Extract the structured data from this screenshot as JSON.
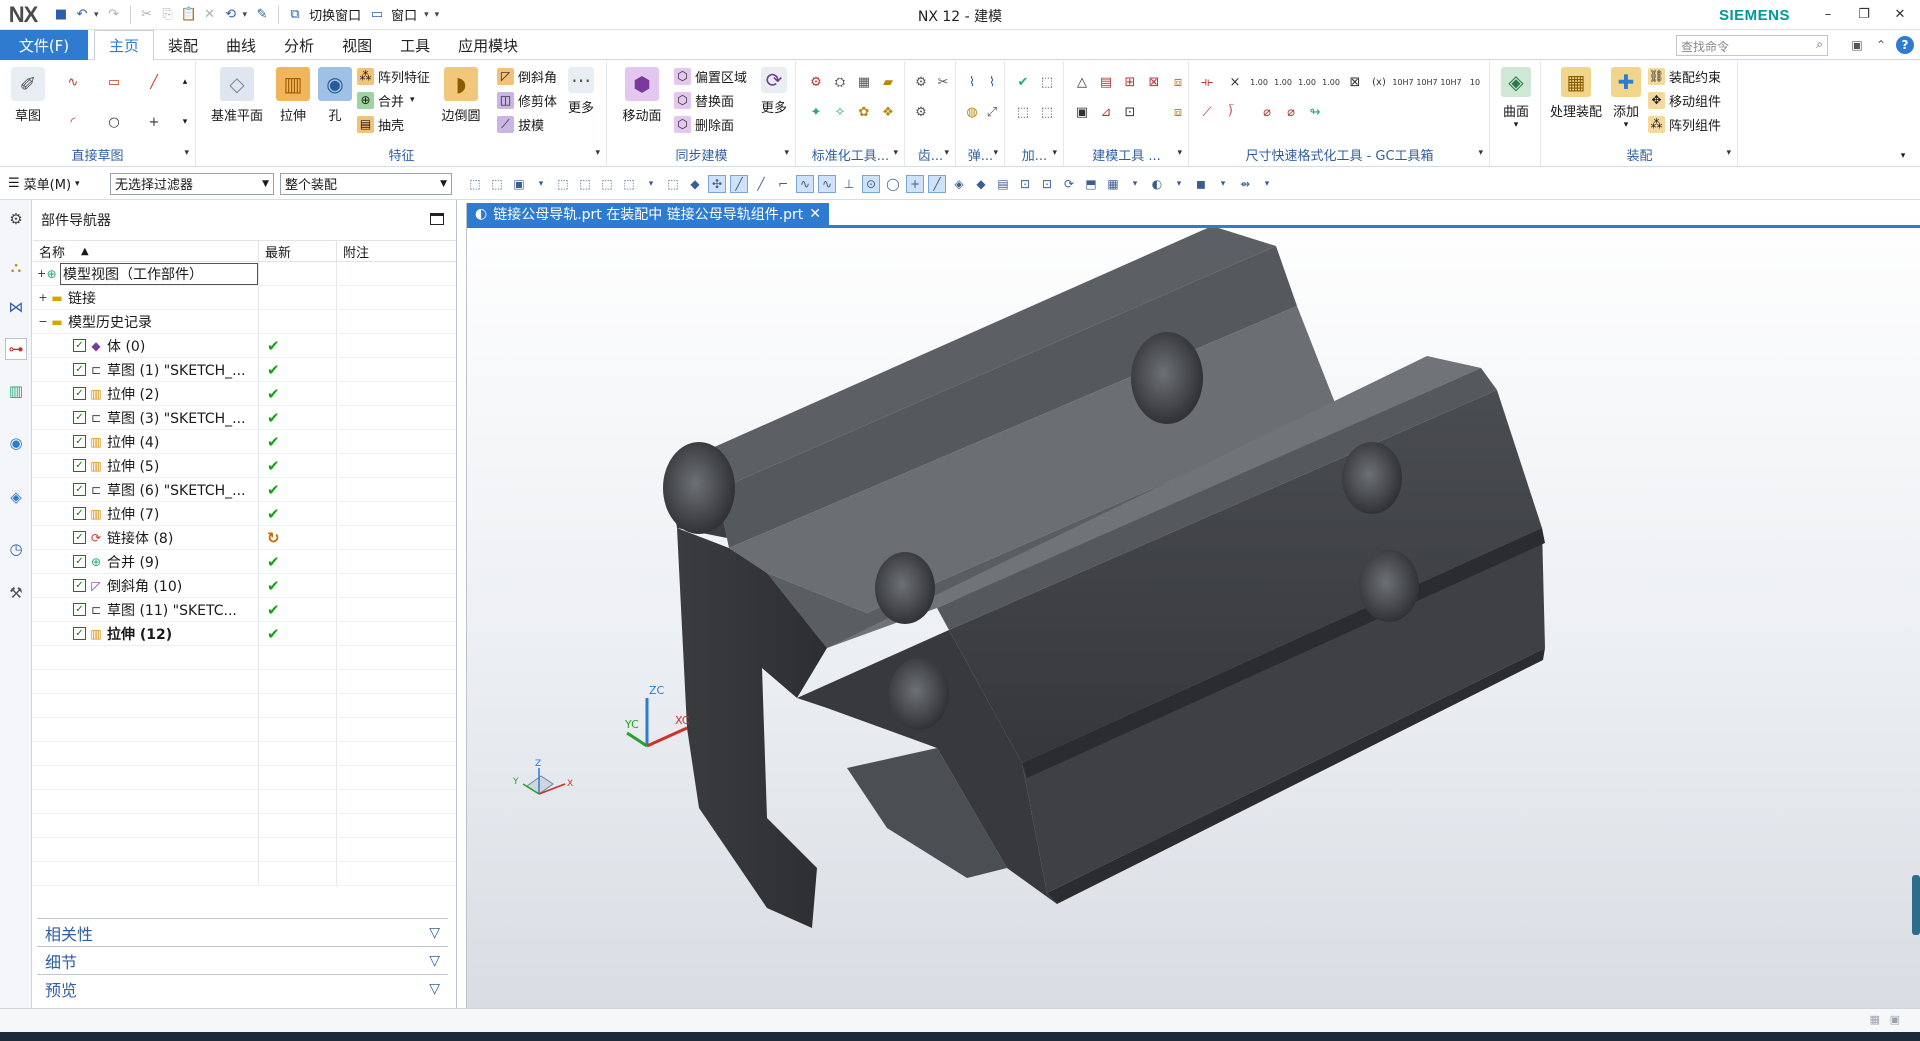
{
  "app": {
    "logo": "NX",
    "window_title": "NX 12 - 建模",
    "brand": "SIEMENS",
    "quick_access": {
      "switch_window": "切换窗口",
      "window": "窗口"
    }
  },
  "menu": {
    "file": "文件(F)",
    "tabs": [
      "主页",
      "装配",
      "曲线",
      "分析",
      "视图",
      "工具",
      "应用模块"
    ],
    "active_tab": "主页",
    "search_placeholder": "查找命令"
  },
  "ribbon": {
    "direct_sketch": {
      "label": "直接草图",
      "sketch": "草图"
    },
    "feature": {
      "label": "特征",
      "datum_plane": "基准平面",
      "extrude": "拉伸",
      "hole": "孔",
      "pattern_feature": "阵列特征",
      "unite": "合并",
      "shell": "抽壳",
      "edge_blend": "边倒圆",
      "chamfer": "倒斜角",
      "trim_body": "修剪体",
      "draft": "拔模",
      "more": "更多"
    },
    "sync_modeling": {
      "label": "同步建模",
      "move_face": "移动面",
      "offset_region": "偏置区域",
      "replace_face": "替换面",
      "delete_face": "删除面",
      "more": "更多"
    },
    "standard_tools": "标准化工具...",
    "gear": "齿...",
    "spring": "弹...",
    "machining": "加...",
    "modeling_tools": "建模工具 ...",
    "gc_toolkit": "尺寸快速格式化工具 - GC工具箱",
    "surface": "曲面",
    "assembly": {
      "label": "装配",
      "process_assembly": "处理装配",
      "add": "添加",
      "constraint": "装配约束",
      "move_component": "移动组件",
      "pattern_component": "阵列组件"
    }
  },
  "selection_bar": {
    "menu": "菜单(M)",
    "type_filter": "无选择过滤器",
    "scope": "整个装配"
  },
  "navigator": {
    "title": "部件导航器",
    "columns": [
      "名称",
      "最新",
      "附注"
    ],
    "model_view": "模型视图（工作部件）",
    "links": "链接",
    "history": "模型历史记录",
    "features": [
      {
        "name": "体 (0)",
        "icon": "body-icon",
        "status": "✔"
      },
      {
        "name": "草图 (1) \"SKETCH_...",
        "icon": "sketch-icon",
        "status": "✔"
      },
      {
        "name": "拉伸 (2)",
        "icon": "extrude-icon",
        "status": "✔"
      },
      {
        "name": "草图 (3) \"SKETCH_...",
        "icon": "sketch-icon",
        "status": "✔"
      },
      {
        "name": "拉伸 (4)",
        "icon": "extrude-icon",
        "status": "✔"
      },
      {
        "name": "拉伸 (5)",
        "icon": "extrude-icon",
        "status": "✔"
      },
      {
        "name": "草图 (6) \"SKETCH_...",
        "icon": "sketch-icon",
        "status": "✔"
      },
      {
        "name": "拉伸 (7)",
        "icon": "extrude-icon",
        "status": "✔"
      },
      {
        "name": "链接体 (8)",
        "icon": "linked-body-icon",
        "status": "↻"
      },
      {
        "name": "合并 (9)",
        "icon": "unite-icon",
        "status": "✔"
      },
      {
        "name": "倒斜角 (10)",
        "icon": "chamfer-icon",
        "status": "✔"
      },
      {
        "name": "草图 (11) \"SKETC...",
        "icon": "sketch-icon",
        "status": "✔"
      },
      {
        "name": "拉伸 (12)",
        "icon": "extrude-icon",
        "status": "✔"
      }
    ],
    "panels": [
      "相关性",
      "细节",
      "预览"
    ]
  },
  "graphics": {
    "tab_title": "链接公母导轨.prt 在装配中 链接公母导轨组件.prt",
    "csys": {
      "x": "XC",
      "y": "YC",
      "z": "ZC"
    },
    "triad": {
      "x": "X",
      "y": "Y",
      "z": "Z"
    },
    "colors": {
      "part": "#4a4c4f",
      "part_dark": "#333538",
      "part_light": "#5d6064",
      "accent": "#2f7bd0"
    }
  }
}
